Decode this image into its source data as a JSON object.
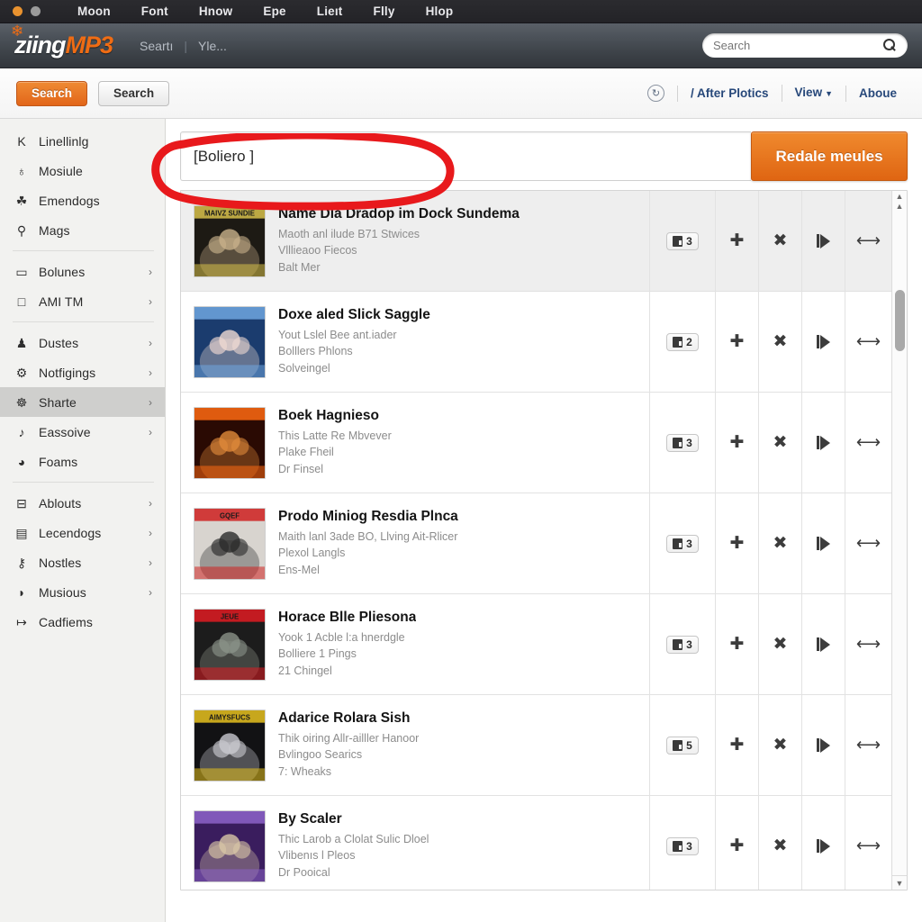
{
  "window": {
    "traffic_lights": [
      "close",
      "minimize"
    ],
    "menu_items": [
      "Moon",
      "Font",
      "Hnow",
      "Epe",
      "Lieıt",
      "Flly",
      "Hlop"
    ]
  },
  "brand": {
    "logo_primary": "ziing",
    "logo_accent": "MP3",
    "paw_icon": "paw-icon",
    "links": [
      "Seartı",
      "Yle..."
    ],
    "separator": "|",
    "header_search": {
      "placeholder": "Search",
      "value": "",
      "icon": "search-icon"
    }
  },
  "toolbar": {
    "primary_button": "Search",
    "secondary_button": "Search",
    "refresh_icon": "refresh-circle-icon",
    "links": [
      {
        "label": "/ After Plotics",
        "has_caret": false
      },
      {
        "label": "View",
        "has_caret": true
      },
      {
        "label": "Aboue",
        "has_caret": false
      }
    ]
  },
  "sidebar": {
    "items": [
      {
        "label": "Linellinlg",
        "icon": "k-letter-icon",
        "glyph": "K",
        "chevron": false,
        "active": false,
        "divider_after": false
      },
      {
        "label": "Mosiule",
        "icon": "globe-icon",
        "glyph": "♁",
        "chevron": false,
        "active": false,
        "divider_after": false
      },
      {
        "label": "Emendogs",
        "icon": "flower-icon",
        "glyph": "☘",
        "chevron": false,
        "active": false,
        "divider_after": false
      },
      {
        "label": "Mags",
        "icon": "stamp-icon",
        "glyph": "⚲",
        "chevron": false,
        "active": false,
        "divider_after": true
      },
      {
        "label": "Bolunes",
        "icon": "monitor-icon",
        "glyph": "▭",
        "chevron": true,
        "active": false,
        "divider_after": false
      },
      {
        "label": "AMI TM",
        "icon": "square-icon",
        "glyph": "□",
        "chevron": true,
        "active": false,
        "divider_after": true
      },
      {
        "label": "Dustes",
        "icon": "person-icon",
        "glyph": "♟",
        "chevron": true,
        "active": false,
        "divider_after": false
      },
      {
        "label": "Notfigings",
        "icon": "gear-icon",
        "glyph": "⚙",
        "chevron": true,
        "active": false,
        "divider_after": false
      },
      {
        "label": "Sharte",
        "icon": "share-icon",
        "glyph": "☸",
        "chevron": true,
        "active": true,
        "divider_after": false
      },
      {
        "label": "Eassoive",
        "icon": "headphone-icon",
        "glyph": "♪",
        "chevron": true,
        "active": false,
        "divider_after": false
      },
      {
        "label": "Foams",
        "icon": "clock-icon",
        "glyph": "◕",
        "chevron": false,
        "active": false,
        "divider_after": true
      },
      {
        "label": "Ablouts",
        "icon": "minus-box-icon",
        "glyph": "⊟",
        "chevron": true,
        "active": false,
        "divider_after": false
      },
      {
        "label": "Lecendogs",
        "icon": "bookshelf-icon",
        "glyph": "▤",
        "chevron": true,
        "active": false,
        "divider_after": false
      },
      {
        "label": "Nostles",
        "icon": "binoculars-icon",
        "glyph": "⚷",
        "chevron": true,
        "active": false,
        "divider_after": false
      },
      {
        "label": "Musious",
        "icon": "speaker-icon",
        "glyph": "◗",
        "chevron": true,
        "active": false,
        "divider_after": false
      },
      {
        "label": "Cadfiems",
        "icon": "arrow-right-icon",
        "glyph": "↦",
        "chevron": false,
        "active": false,
        "divider_after": false
      }
    ]
  },
  "main": {
    "search_box": {
      "value": "[Boliero ]",
      "placeholder": ""
    },
    "action_button": "Redale meules",
    "annotation": {
      "shape": "red-ellipse",
      "color": "#e8191c"
    },
    "rows": [
      {
        "title": "Name Dia Dradop im Dock Sundema",
        "line2": "Maoth anl ilude B71 Stwices",
        "line3": "Vlllieaoo Fiecos",
        "line4": "Balt Mer",
        "badge_count": "3",
        "selected": true,
        "art": {
          "bg": "#1d1a14",
          "band": "#d8c24b",
          "fg": "#c8b08a",
          "caption": "MAIVZ SUNDIE"
        }
      },
      {
        "title": "Doxe aled Slick Saggle",
        "line2": "Yout Lslel Bee ant.iader",
        "line3": "Bolllers Phlons",
        "line4": "Solveingel",
        "badge_count": "2",
        "selected": false,
        "art": {
          "bg": "#1b3c6e",
          "band": "#6fa6e0",
          "fg": "#efd9d2",
          "caption": ""
        }
      },
      {
        "title": "Boek Hagnieso",
        "line2": "This Latte Re Mbvever",
        "line3": "Plake Fheil",
        "line4": "Dr Finsel",
        "badge_count": "3",
        "selected": false,
        "art": {
          "bg": "#2a0a03",
          "band": "#ff6a12",
          "fg": "#e08a3a",
          "caption": ""
        }
      },
      {
        "title": "Prodo Miniog Resdia Plnca",
        "line2": "Maith lanl 3ade BO, Llving Ait-Rlicer",
        "line3": "Plexol Langls",
        "line4": "Ens-Mel",
        "badge_count": "3",
        "selected": false,
        "art": {
          "bg": "#d8d4cf",
          "band": "#cf2020",
          "fg": "#2a2a2a",
          "caption": "GQEF"
        }
      },
      {
        "title": "Horace Blle Pliesona",
        "line2": "Yook 1 Acble l:a hnerdgle",
        "line3": "Bolliere 1 Pings",
        "line4": "21 Chingel",
        "badge_count": "3",
        "selected": false,
        "art": {
          "bg": "#1c1c1c",
          "band": "#e11b22",
          "fg": "#8b9288",
          "caption": "JEUE"
        }
      },
      {
        "title": "Adarice Rolara Sish",
        "line2": "Thik oiring Allr-ailller Hanoor",
        "line3": "Bvlingoo Searics",
        "line4": "7: Wheaks",
        "badge_count": "5",
        "selected": false,
        "art": {
          "bg": "#121214",
          "band": "#e8c21e",
          "fg": "#c9c9cf",
          "caption": "AIMYSFUCS"
        }
      },
      {
        "title": "By Scaler",
        "line2": "Thic Larob a Clolat Sulic Dloel",
        "line3": "Vlibenıs l Pleos",
        "line4": "Dr Pooical",
        "badge_count": "3",
        "selected": false,
        "art": {
          "bg": "#3a1d5e",
          "band": "#8d63c9",
          "fg": "#d8c6a6",
          "caption": ""
        }
      }
    ],
    "row_actions": [
      {
        "name": "add-icon",
        "glyph": "✚"
      },
      {
        "name": "close-icon",
        "glyph": "✖"
      },
      {
        "name": "play-icon",
        "glyph": "play"
      },
      {
        "name": "expand-icon",
        "glyph": "↔"
      }
    ],
    "scrollbar": {
      "up_arrow": "▲",
      "up_arrow_2": "▲",
      "down_arrow": "▼"
    }
  }
}
